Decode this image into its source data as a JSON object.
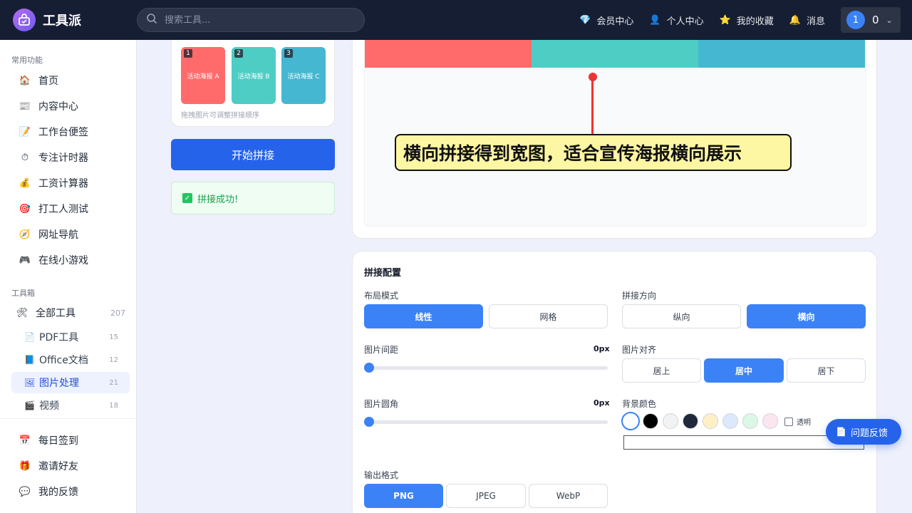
{
  "app": {
    "name": "工具派"
  },
  "search": {
    "placeholder": "搜索工具..."
  },
  "nav": {
    "member": "会员中心",
    "profile": "个人中心",
    "favorites": "我的收藏",
    "messages": "消息"
  },
  "user": {
    "avatar": "1",
    "count": "0"
  },
  "sidebar": {
    "section_common": "常用功能",
    "common_items": [
      {
        "label": "首页",
        "icon": "home-icon"
      },
      {
        "label": "内容中心",
        "icon": "newspaper-icon"
      },
      {
        "label": "工作台便签",
        "icon": "memo-icon"
      },
      {
        "label": "专注计时器",
        "icon": "timer-icon"
      },
      {
        "label": "工资计算器",
        "icon": "money-bag-icon"
      },
      {
        "label": "打工人测试",
        "icon": "target-icon"
      },
      {
        "label": "网址导航",
        "icon": "compass-icon"
      },
      {
        "label": "在线小游戏",
        "icon": "gamepad-icon"
      }
    ],
    "section_tools": "工具箱",
    "all_tools": {
      "label": "全部工具",
      "count": "207"
    },
    "tool_items": [
      {
        "label": "PDF工具",
        "count": "15"
      },
      {
        "label": "Office文档",
        "count": "12"
      },
      {
        "label": "图片处理",
        "count": "21"
      },
      {
        "label": "视频",
        "count": "18"
      }
    ],
    "bottom_items": [
      {
        "label": "每日签到",
        "icon": "calendar-icon"
      },
      {
        "label": "邀请好友",
        "icon": "gift-icon"
      },
      {
        "label": "我的反馈",
        "icon": "speech-bubble-icon"
      }
    ]
  },
  "thumbs": {
    "items": [
      {
        "num": "1",
        "label": "活动海报 A",
        "color": "#ff6b6b"
      },
      {
        "num": "2",
        "label": "活动海报 B",
        "color": "#4ecdc4"
      },
      {
        "num": "3",
        "label": "活动海报 C",
        "color": "#45b7d1"
      }
    ],
    "hint": "拖拽图片可调整拼接顺序"
  },
  "actions": {
    "start": "开始拼接",
    "success": "拼接成功!"
  },
  "preview": {
    "strip_colors": [
      "#ff6b6b",
      "#4ecdc4",
      "#45b7d1"
    ],
    "callout": "横向拼接得到宽图，适合宣传海报横向展示"
  },
  "config": {
    "title": "拼接配置",
    "layout_label": "布局模式",
    "layout_options": [
      "线性",
      "网格"
    ],
    "layout_selected": "线性",
    "direction_label": "拼接方向",
    "direction_options": [
      "纵向",
      "横向"
    ],
    "direction_selected": "横向",
    "gap_label": "图片间距",
    "gap_value": "0px",
    "align_label": "图片对齐",
    "align_options": [
      "居上",
      "居中",
      "居下"
    ],
    "align_selected": "居中",
    "radius_label": "图片圆角",
    "radius_value": "0px",
    "bg_label": "背景颜色",
    "bg_swatches": [
      "#ffffff",
      "#000000",
      "#f1f2f4",
      "#1e293b",
      "#fdf0c7",
      "#dce8fb",
      "#dcf7e6",
      "#fbe5ef"
    ],
    "transparent_label": "透明",
    "output_label": "输出格式",
    "output_options": [
      "PNG",
      "JPEG",
      "WebP"
    ],
    "output_selected": "PNG"
  },
  "feedback": {
    "label": "问题反馈"
  }
}
